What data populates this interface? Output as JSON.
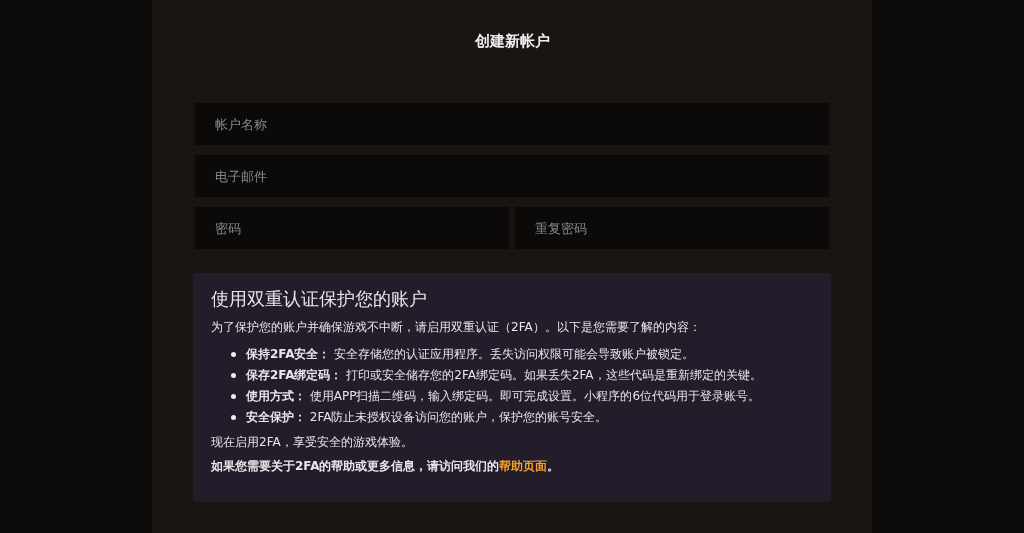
{
  "form": {
    "title": "创建新帐户",
    "fields": [
      {
        "placeholder": "帐户名称"
      },
      {
        "placeholder": "电子邮件"
      }
    ],
    "password_fields": [
      {
        "placeholder": "密码"
      },
      {
        "placeholder": "重复密码"
      }
    ]
  },
  "info_box": {
    "heading": "使用双重认证保护您的账户",
    "intro": "为了保护您的账户并确保游戏不中断，请启用双重认证（2FA）。以下是您需要了解的内容：",
    "items": [
      {
        "term": "保持2FA安全：",
        "text": "安全存储您的认证应用程序。丢失访问权限可能会导致账户被锁定。"
      },
      {
        "term": "保存2FA绑定码：",
        "text": "打印或安全储存您的2FA绑定码。如果丢失2FA，这些代码是重新绑定的关键。"
      },
      {
        "term": "使用方式：",
        "text": "使用APP扫描二维码，输入绑定码。即可完成设置。小程序的6位代码用于登录账号。"
      },
      {
        "term": "安全保护：",
        "text": "2FA防止未授权设备访问您的账户，保护您的账号安全。"
      }
    ],
    "outro": "现在启用2FA，享受安全的游戏体验。",
    "help_text": "如果您需要关于2FA的帮助或更多信息，请访问我们的",
    "help_link": "帮助页面",
    "help_end": "。"
  }
}
